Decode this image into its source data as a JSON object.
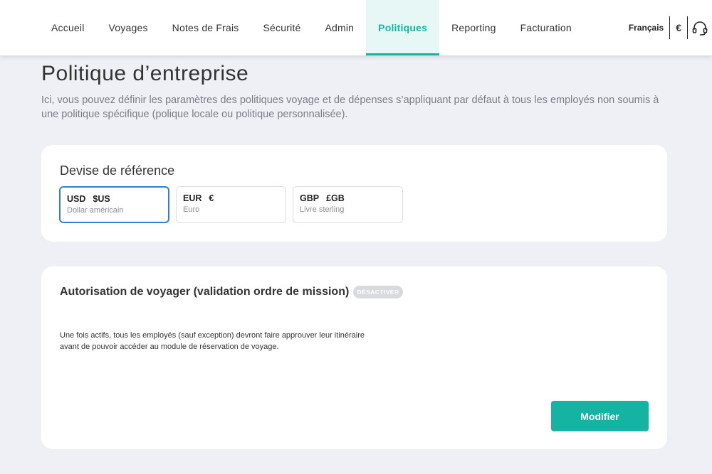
{
  "nav": {
    "items": [
      {
        "label": "Accueil",
        "active": false
      },
      {
        "label": "Voyages",
        "active": false
      },
      {
        "label": "Notes de Frais",
        "active": false
      },
      {
        "label": "Sécurité",
        "active": false
      },
      {
        "label": "Admin",
        "active": false
      },
      {
        "label": "Politiques",
        "active": true
      },
      {
        "label": "Reporting",
        "active": false
      },
      {
        "label": "Facturation",
        "active": false
      }
    ],
    "language": "Français",
    "currency": "€",
    "accent_color": "#14b3a2"
  },
  "page": {
    "title": "Politique d’entreprise",
    "description": "Ici, vous pouvez définir les paramètres des politiques voyage et de dépenses s’appliquant par défaut à tous les employés non soumis à une politique spécifique (polique locale ou politique personnalisée)."
  },
  "currency_card": {
    "title": "Devise de référence",
    "options": [
      {
        "code": "USD",
        "symbol": "$US",
        "name": "Dollar américain",
        "selected": true
      },
      {
        "code": "EUR",
        "symbol": "€",
        "name": "Euro",
        "selected": false
      },
      {
        "code": "GBP",
        "symbol": "£GB",
        "name": "Livre sterling",
        "selected": false
      }
    ]
  },
  "travel_card": {
    "title": "Autorisation de voyager (validation ordre de mission)",
    "badge": "DÉSACTIVER",
    "description": "Une fois actifs, tous les employés (sauf exception) devront faire approuver leur itinéraire avant de pouvoir accéder au module de réservation de voyage.",
    "button_label": "Modifier"
  }
}
